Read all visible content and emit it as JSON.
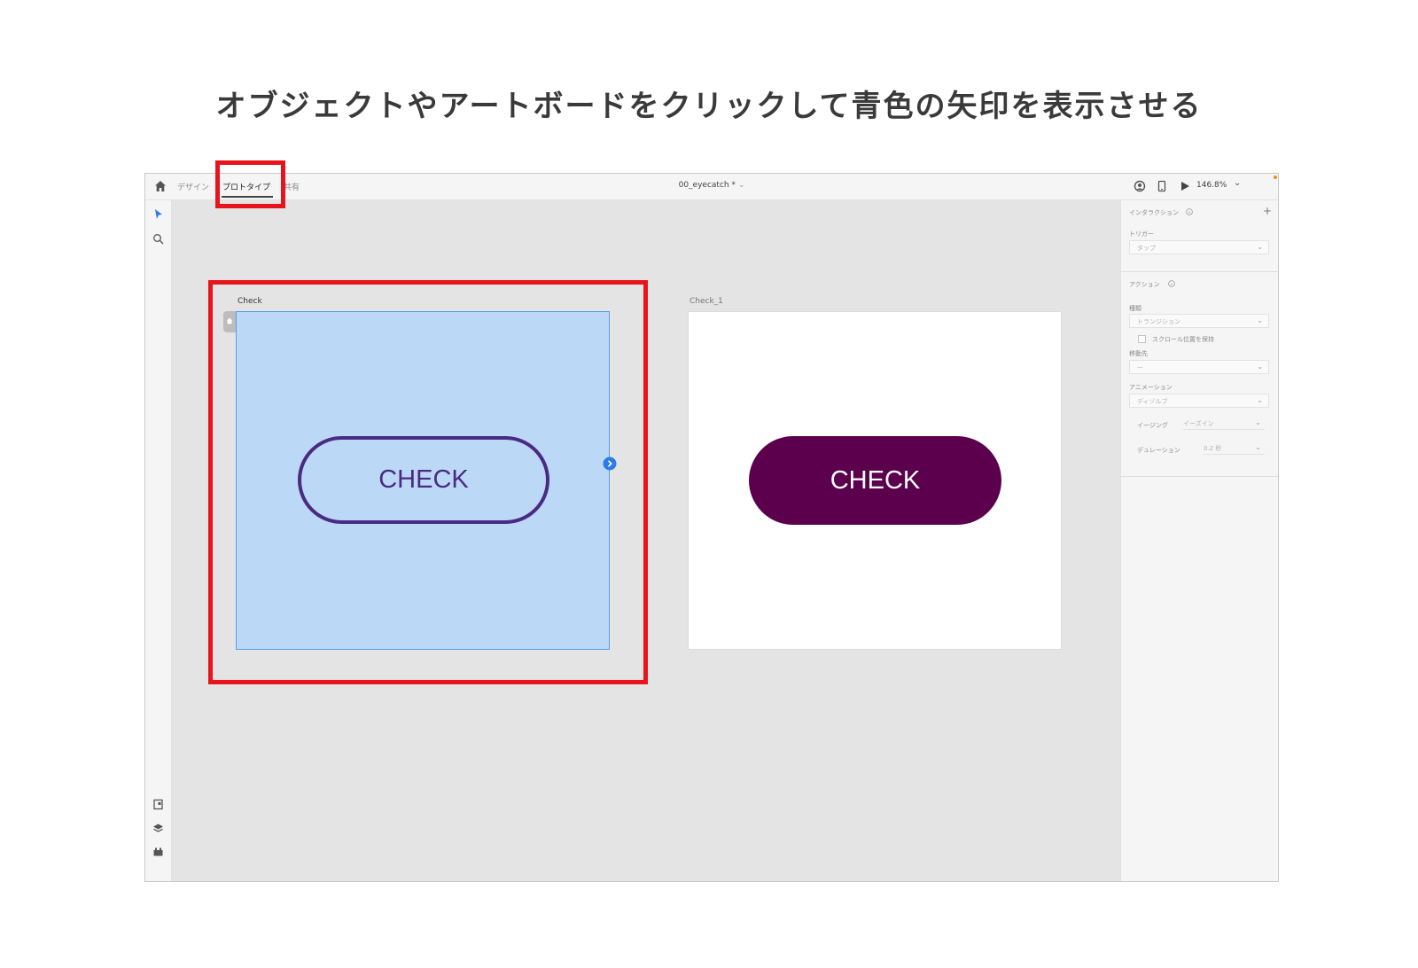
{
  "heading": "オブジェクトやアートボードをクリックして青色の矢印を表示させる",
  "toolbar": {
    "tab_design": "デザイン",
    "tab_prototype": "プロトタイプ",
    "tab_share": "共有",
    "document_title": "00_eyecatch *",
    "zoom": "146.8%"
  },
  "artboards": {
    "left_label": "Check",
    "right_label": "Check_1",
    "left_button": "CHECK",
    "right_button": "CHECK"
  },
  "panel": {
    "interaction_title": "インタラクション",
    "add_symbol": "+",
    "trigger_label": "トリガー",
    "trigger_value": "タップ",
    "action_title": "アクション",
    "type_label": "種類",
    "type_value": "トランジション",
    "keep_scroll_label": "スクロール位置を保持",
    "destination_label": "移動先",
    "destination_value": "—",
    "animation_label": "アニメーション",
    "animation_value": "ディゾルブ",
    "easing_label": "イージング",
    "easing_value": "イーズイン",
    "duration_label": "デュレーション",
    "duration_value": "0.2 秒"
  },
  "colors": {
    "highlight_red": "#e8141b",
    "selected_artboard_fill": "#bcd8f7",
    "outline_button_stroke": "#4a2a82",
    "filled_button": "#5c004e",
    "accent_blue": "#2d7be5"
  },
  "icons": [
    "home-icon",
    "coediting-icon",
    "device-icon",
    "play-icon",
    "chevron-down-icon",
    "select-arrow-icon",
    "search-icon",
    "assets-icon",
    "layers-icon",
    "plugins-icon",
    "info-icon",
    "arrow-handle-icon"
  ]
}
